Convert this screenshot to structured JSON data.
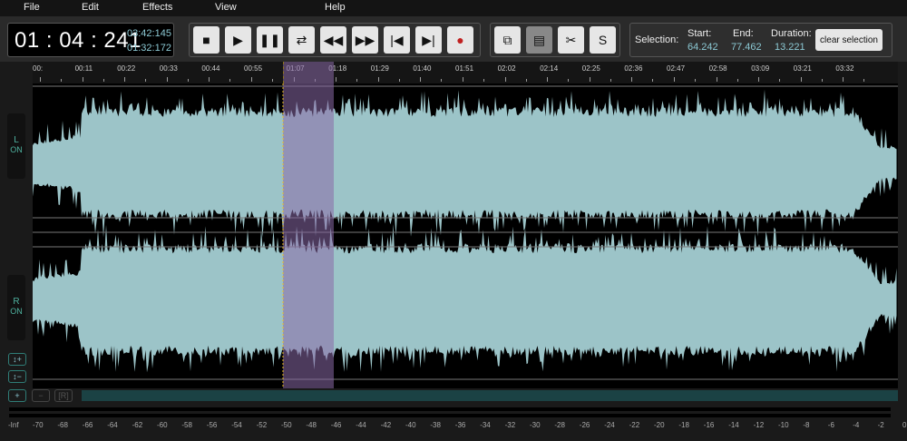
{
  "menu": [
    "File",
    "Edit",
    "Effects",
    "View",
    "Help"
  ],
  "clock": {
    "current": "01 : 04 : 241",
    "total": "03:42:145",
    "remaining": "01:32:172"
  },
  "transport": [
    {
      "icon": "stop-icon",
      "glyph": "■"
    },
    {
      "icon": "play-icon",
      "glyph": "▶"
    },
    {
      "icon": "pause-icon",
      "glyph": "❚❚"
    },
    {
      "icon": "loop-icon",
      "glyph": "⇄"
    },
    {
      "icon": "rewind-icon",
      "glyph": "◀◀"
    },
    {
      "icon": "fast-forward-icon",
      "glyph": "▶▶"
    },
    {
      "icon": "skip-start-icon",
      "glyph": "|◀"
    },
    {
      "icon": "skip-end-icon",
      "glyph": "▶|"
    },
    {
      "icon": "record-icon",
      "glyph": "●"
    }
  ],
  "edit_tools": [
    {
      "icon": "copy-icon",
      "glyph": "⧉",
      "disabled": false
    },
    {
      "icon": "paste-icon",
      "glyph": "▤",
      "disabled": true
    },
    {
      "icon": "cut-icon",
      "glyph": "✂",
      "disabled": false
    },
    {
      "icon": "s-icon",
      "glyph": "S",
      "disabled": false
    }
  ],
  "selection": {
    "label": "Selection:",
    "start_label": "Start:",
    "start": "64.242",
    "end_label": "End:",
    "end": "77.462",
    "duration_label": "Duration:",
    "duration": "13.221",
    "clear": "clear selection"
  },
  "timeline": [
    "00:",
    "00:11",
    "00:22",
    "00:33",
    "00:44",
    "00:55",
    "01:07",
    "01:18",
    "01:29",
    "01:40",
    "01:51",
    "02:02",
    "02:14",
    "02:25",
    "02:36",
    "02:47",
    "02:58",
    "03:09",
    "03:21",
    "03:32"
  ],
  "channels": [
    {
      "name": "L",
      "state": "ON"
    },
    {
      "name": "R",
      "state": "ON"
    }
  ],
  "zoom_controls": {
    "v_in": "↕+",
    "v_out": "↕−",
    "h_in": "+",
    "h_out": "−",
    "reset": "[R]"
  },
  "db_scale": [
    "-Inf",
    "-70",
    "-68",
    "-66",
    "-64",
    "-62",
    "-60",
    "-58",
    "-56",
    "-54",
    "-52",
    "-50",
    "-48",
    "-46",
    "-44",
    "-42",
    "-40",
    "-38",
    "-36",
    "-34",
    "-32",
    "-30",
    "-28",
    "-26",
    "-24",
    "-22",
    "-20",
    "-18",
    "-16",
    "-14",
    "-12",
    "-10",
    "-8",
    "-6",
    "-4",
    "-2",
    "0"
  ],
  "colors": {
    "waveform": "#9cc4c8",
    "selection": "#8a6aa8",
    "cursor": "#f0c020",
    "accent": "#8cc9d4"
  }
}
